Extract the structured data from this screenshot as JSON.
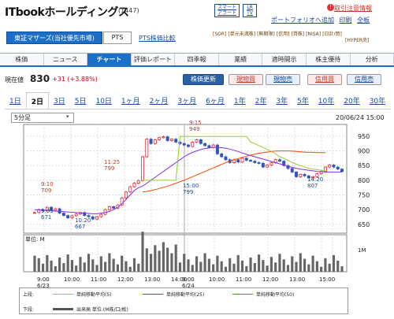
{
  "header": {
    "title": "ITbookホールディングス",
    "code": "(1447)",
    "smart_alert_label": "スマートアラート",
    "lr_label": "LR TV",
    "announcement_label": "取引注意情報",
    "portfolio_label": "ポートフォリオへ追加",
    "print_label": "印刷",
    "full_label": "全板"
  },
  "market": {
    "selected": "東証マザーズ(当社優先市場)",
    "pts_label": "PTS",
    "pts_compare_label": "PTS株価比較",
    "tags_line1": [
      "[SOR]",
      "[単元未満株]",
      "[無期限]",
      "[信用]",
      "[貸株]",
      "[NISA]",
      "[日計/買]"
    ],
    "tags_line2": [
      "[HYPER売]"
    ]
  },
  "nav": {
    "items": [
      "株価",
      "ニュース",
      "チャート",
      "評価レポート",
      "四季報",
      "業績",
      "適時開示",
      "株主優待",
      "分析"
    ],
    "active_index": 2
  },
  "quote": {
    "label": "現在値",
    "price": "830",
    "change": "+31 (+3.88%)",
    "refresh_label": "株価更新",
    "buttons": [
      "現物買",
      "現物売",
      "信用買",
      "信用売"
    ]
  },
  "ranges": {
    "items": [
      "1日",
      "2日",
      "3日",
      "5日",
      "10日",
      "1ヶ月",
      "2ヶ月",
      "3ヶ月",
      "6ヶ月",
      "1年",
      "2年",
      "3年",
      "5年",
      "10年",
      "20年",
      "30年"
    ],
    "active_index": 1
  },
  "interval": "5分足",
  "datetime": "20/06/24 15:00",
  "volume_unit_label": "単位: M",
  "volume_axis_label": "1M",
  "annotations": [
    {
      "time": "9:10",
      "value": "709"
    },
    {
      "time": "9:05",
      "value": "671"
    },
    {
      "time": "10:20",
      "value": "667"
    },
    {
      "time": "11:25",
      "value": "799"
    },
    {
      "time": "9:15",
      "value": "949"
    },
    {
      "time": "15:00",
      "value": "799"
    },
    {
      "time": "14:20",
      "value": "807"
    }
  ],
  "legend": {
    "top_label": "上段:",
    "ma5": "単純移動平均(5)",
    "ma25": "単純移動平均(25)",
    "ma50": "単純移動平均(50)",
    "bottom_label": "下段:",
    "volume": "出来高 単位:(M株/口/枚)",
    "colors": {
      "ma5": "#9acd32",
      "ma25": "#8a2be2",
      "ma50": "#ff4500",
      "up": "#e32636",
      "down": "#3355bb"
    }
  },
  "chart_data": {
    "type": "candlestick",
    "interval": "5分足",
    "y_ticks": [
      650,
      700,
      750,
      800,
      850,
      900,
      950
    ],
    "ylim": [
      620,
      990
    ],
    "volume_ticks": [
      "1M"
    ],
    "x_ticks": [
      "9:00",
      "10:00",
      "11:00",
      "12:00",
      "13:00",
      "14:00",
      "15:00"
    ],
    "sessions": [
      {
        "date": "6/23",
        "label": "6/23"
      },
      {
        "date": "6/24",
        "label": "6/24"
      }
    ],
    "price_series": [
      690,
      700,
      696,
      708,
      698,
      703,
      688,
      680,
      672,
      679,
      685,
      690,
      680,
      676,
      668,
      676,
      684,
      700,
      710,
      705,
      716,
      740,
      760,
      778,
      790,
      799,
      880,
      940,
      925,
      938,
      945,
      948,
      935,
      940,
      930,
      925,
      920,
      915,
      930,
      938,
      925,
      918,
      912,
      920,
      890,
      880,
      870,
      860,
      870,
      862,
      875,
      868,
      865,
      860,
      858,
      845,
      852,
      860,
      870,
      865,
      850,
      840,
      828,
      812,
      820,
      815,
      808,
      812,
      822,
      830,
      845,
      852,
      845,
      838,
      830
    ],
    "ma5": [
      null,
      null,
      null,
      null,
      null,
      null,
      null,
      null,
      null,
      null,
      null,
      null,
      null,
      null,
      null,
      null,
      null,
      null,
      null,
      null,
      null,
      null,
      null,
      null,
      null,
      null,
      800,
      800,
      800,
      800,
      800,
      800,
      800,
      800,
      800,
      949,
      949,
      949,
      949,
      949,
      949,
      949,
      949,
      949,
      949,
      949,
      949,
      949,
      949,
      949,
      949,
      949,
      930,
      925,
      918,
      912,
      905,
      898,
      890,
      880,
      875,
      868,
      860,
      855,
      850,
      845,
      840,
      838,
      836,
      834,
      832
    ],
    "ma25": [
      700,
      699,
      698,
      697,
      696,
      695,
      694,
      693,
      692,
      691,
      690,
      689,
      688,
      687,
      686,
      686,
      688,
      690,
      694,
      700,
      708,
      720,
      735,
      750,
      765,
      775,
      780,
      790,
      800,
      810,
      820,
      830,
      840,
      850,
      860,
      870,
      880,
      888,
      895,
      900,
      905,
      908,
      910,
      912,
      912,
      911,
      909,
      906,
      902,
      898,
      893,
      888,
      884,
      880,
      876,
      872,
      868,
      864,
      860,
      856,
      852,
      848,
      844,
      841,
      838,
      836,
      834,
      832,
      830,
      829,
      828,
      828,
      828,
      828,
      828
    ],
    "ma50": [
      null,
      null,
      null,
      null,
      null,
      null,
      null,
      null,
      null,
      null,
      null,
      null,
      null,
      null,
      null,
      null,
      null,
      null,
      null,
      null,
      null,
      null,
      null,
      null,
      null,
      null,
      760,
      762,
      765,
      768,
      772,
      776,
      780,
      785,
      790,
      795,
      800,
      806,
      812,
      818,
      824,
      830,
      836,
      842,
      848,
      854,
      860,
      866,
      870,
      874,
      878,
      882,
      886,
      889,
      892,
      894,
      896,
      898,
      899,
      900,
      900,
      900,
      899,
      898,
      897,
      896,
      895,
      895,
      894,
      894,
      894
    ]
  }
}
